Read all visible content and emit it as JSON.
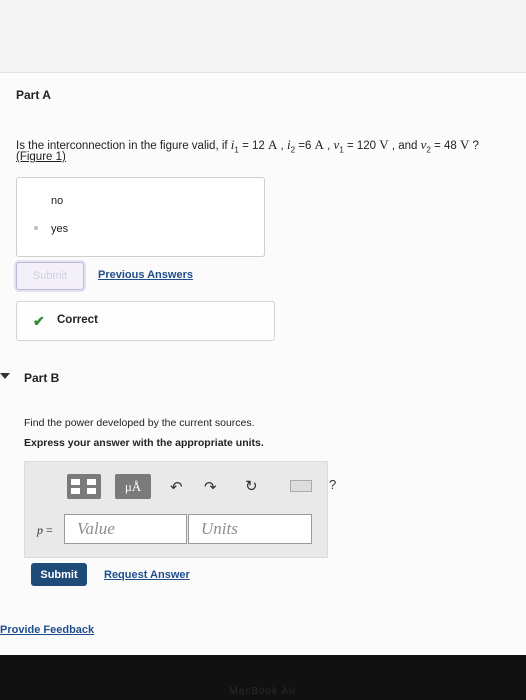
{
  "part_a": {
    "title": "Part A",
    "question": {
      "prefix": "Is the interconnection in the figure valid, if ",
      "i1_var": "i",
      "i1_sub": "1",
      "i1_eq": " = 12 ",
      "i1_unit": "A",
      "sep1": " , ",
      "i2_var": "i",
      "i2_sub": "2",
      "i2_eq": " =6 ",
      "i2_unit": "A",
      "sep2": " , ",
      "v1_var": "v",
      "v1_sub": "1",
      "v1_eq": " = 120 ",
      "v1_unit": "V",
      "and_text": " , and ",
      "v2_var": "v",
      "v2_sub": "2",
      "v2_eq": " = 48 ",
      "v2_unit": "V",
      "suffix": " ?"
    },
    "figure_link": "(Figure 1)",
    "choices": [
      "no",
      "yes"
    ],
    "submit_label": "Submit",
    "previous_answers": "Previous Answers",
    "correct_label": "Correct"
  },
  "part_b": {
    "title": "Part B",
    "instruction": "Find the power developed by the current sources.",
    "express": "Express your answer with the appropriate units.",
    "toolbar": {
      "mu_label": "μÅ",
      "help": "?",
      "undo_icon": "undo-icon",
      "redo_icon": "redo-icon",
      "reset_icon": "reset-icon",
      "keyboard_icon": "keyboard-icon"
    },
    "answer_label_var": "p",
    "answer_label_eq": " =",
    "value_placeholder": "Value",
    "units_placeholder": "Units",
    "submit_label": "Submit",
    "request_answer": "Request Answer"
  },
  "footer": {
    "provide_feedback": "Provide Feedback",
    "laptop_label": "MacBook Air"
  },
  "colors": {
    "link": "#1f4e8c",
    "submit_bg": "#1f4b78",
    "correct_check": "#2f8a2f",
    "toolbar_btn": "#7a7a7a"
  }
}
